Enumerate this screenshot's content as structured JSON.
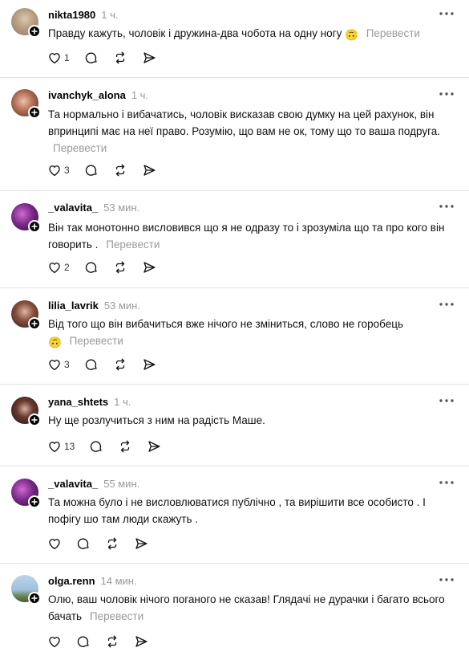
{
  "translate_label": "Перевести",
  "colors": {
    "username": "#000000",
    "timestamp": "#999999",
    "translate": "#9a9a9a",
    "divider": "#e3e3e3"
  },
  "replies": [
    {
      "username": "nikta1980",
      "time": "1 ч.",
      "text": "Правду кажуть, чоловік і дружина-два чобота на одну ногу",
      "emoji": "🙃",
      "likes": "1"
    },
    {
      "username": "ivanchyk_alona",
      "time": "1 ч.",
      "text": "Та нормально і вибачатись, чоловік висказав свою думку на цей рахунок, він впринципі має на неї право. Розумію, що вам не ок, тому що то ваша подруга.",
      "likes": "3"
    },
    {
      "username": "_valavita_",
      "time": "53 мин.",
      "text": "Він так монотонно висловився що я не одразу то і зрозуміла що та про кого він говорить .",
      "likes": "2"
    },
    {
      "username": "lilia_lavrik",
      "time": "53 мин.",
      "text": "Від того що він вибачиться вже нічого не зміниться, слово не горобець",
      "emoji": "🙃",
      "likes": "3"
    },
    {
      "username": "yana_shtets",
      "time": "1 ч.",
      "text": "Ну ще розлучиться з ним на радість Маше.",
      "likes": "13"
    },
    {
      "username": "_valavita_",
      "time": "55 мин.",
      "text": "Та можна було і не висловлюватися публічно , та вирішити все особисто . І пофігу шо там люди скажуть .",
      "likes": ""
    },
    {
      "username": "olga.renn",
      "time": "14 мин.",
      "text": "Олю, ваш чоловік нічого поганого не сказав! Глядачі не дурачки і багато всього бачать",
      "likes": ""
    }
  ]
}
